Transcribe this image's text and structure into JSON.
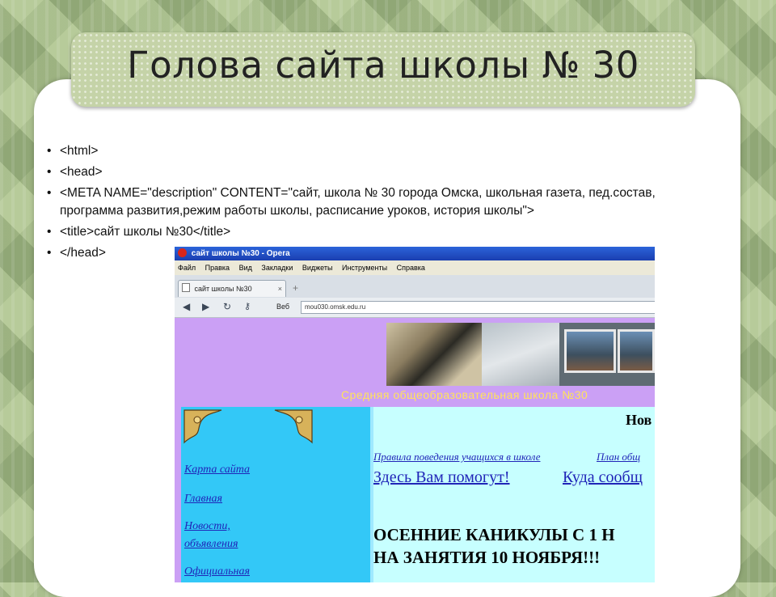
{
  "slide": {
    "title": "Голова сайта школы № 30",
    "bullets": [
      "<html>",
      "<head>",
      "<META NAME=\"description\" CONTENT=\"сайт, школа № 30 города Омска, школьная газета, пед.состав, программа развития,режим работы  школы, расписание уроков, история школы\">",
      "<title>сайт школы №30</title>",
      "</head>"
    ]
  },
  "browser": {
    "window_title": "сайт школы №30 - Opera",
    "menu": [
      "Файл",
      "Правка",
      "Вид",
      "Закладки",
      "Виджеты",
      "Инструменты",
      "Справка"
    ],
    "tab_label": "сайт школы №30",
    "tab_close": "×",
    "new_tab": "+",
    "web_label": "Веб",
    "address": "mou030.omsk.edu.ru",
    "icons": [
      "back-icon",
      "forward-icon",
      "reload-icon",
      "key-icon"
    ]
  },
  "site": {
    "school_name": "Средняя общеобразовательная школа №30",
    "nav_links": [
      "Карта сайта",
      "Главная",
      "Новости,",
      "объявления",
      "Официальная"
    ],
    "news_heading": "Нов",
    "link_rules": "Правила поведения учащихся в школе",
    "link_plan": "План общ",
    "link_help": "Здесь Вам помогут!",
    "link_report": "Куда сообщ",
    "notice_line1": "ОСЕННИЕ КАНИКУЛЫ С 1 Н",
    "notice_line2": "НА ЗАНЯТИЯ 10 НОЯБРЯ!!!"
  }
}
